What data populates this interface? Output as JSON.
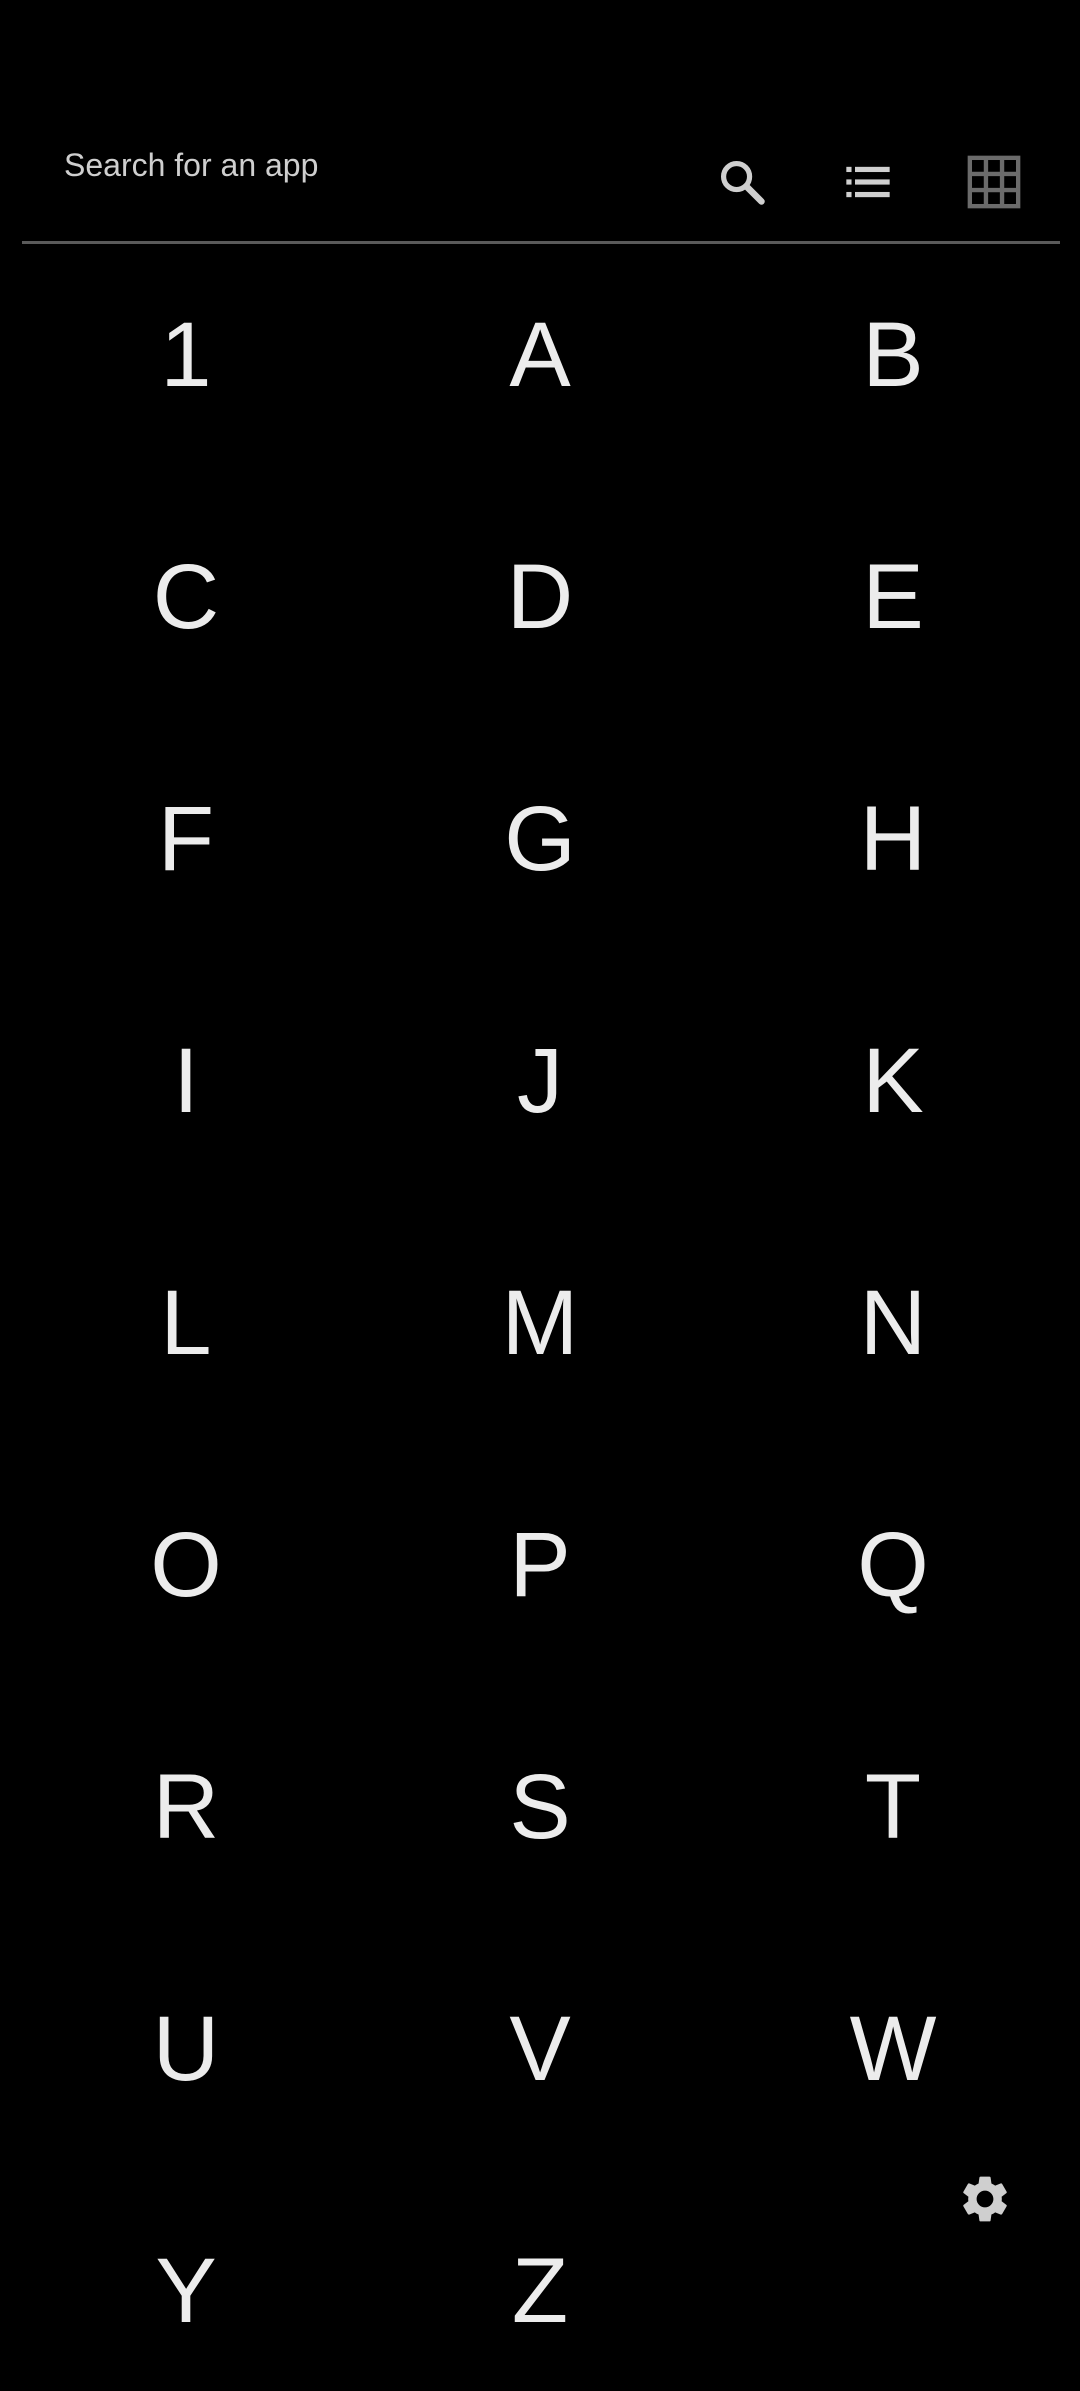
{
  "search": {
    "placeholder": "Search for an app",
    "value": ""
  },
  "toolbar": {
    "icons": [
      "search-icon",
      "list-view-icon",
      "grid-view-icon",
      "settings-icon"
    ],
    "icon_color_active": "#cfcfcf",
    "icon_color_inactive": "#6b6b6b"
  },
  "letters": [
    "1",
    "A",
    "B",
    "C",
    "D",
    "E",
    "F",
    "G",
    "H",
    "I",
    "J",
    "K",
    "L",
    "M",
    "N",
    "O",
    "P",
    "Q",
    "R",
    "S",
    "T",
    "U",
    "V",
    "W",
    "Y",
    "Z"
  ],
  "colors": {
    "background": "#000000",
    "text": "#ececec",
    "divider": "#5a5a5a"
  }
}
